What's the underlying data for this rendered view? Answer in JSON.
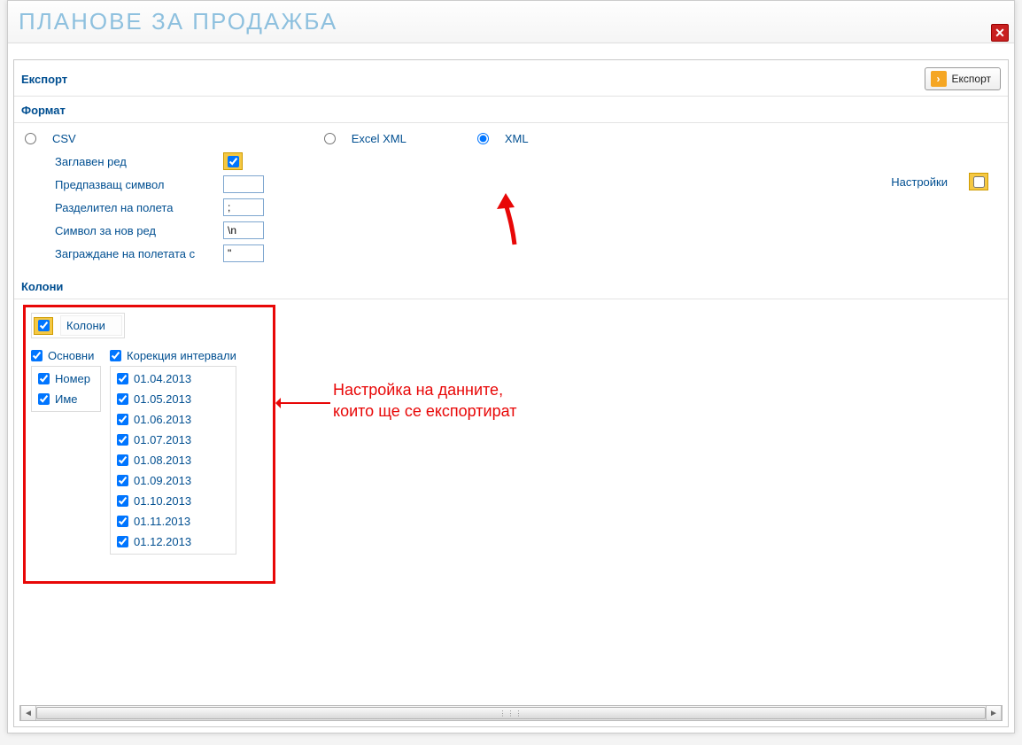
{
  "window": {
    "title": "ПЛАНОВЕ ЗА ПРОДАЖБА"
  },
  "export": {
    "header": "Експорт",
    "button": "Експорт"
  },
  "format": {
    "header": "Формат",
    "csv_label": "CSV",
    "excel_label": "Excel XML",
    "xml_label": "XML",
    "settings_label": "Настройки"
  },
  "csv": {
    "header_row": "Заглавен ред",
    "escape_char": "Предпазващ символ",
    "escape_char_val": "",
    "field_sep": "Разделител на полета",
    "field_sep_val": ";",
    "newline": "Символ за нов ред",
    "newline_val": "\\n",
    "enclose": "Заграждане на полетата с",
    "enclose_val": "\""
  },
  "columns": {
    "header": "Колони",
    "tab_label": "Колони",
    "group_basic": "Основни",
    "group_intervals": "Корекция интервали",
    "basic_items": [
      "Номер",
      "Име"
    ],
    "interval_items": [
      "01.04.2013",
      "01.05.2013",
      "01.06.2013",
      "01.07.2013",
      "01.08.2013",
      "01.09.2013",
      "01.10.2013",
      "01.11.2013",
      "01.12.2013"
    ]
  },
  "annotation": {
    "line1": "Настройка на данните,",
    "line2": "които ще се експортират"
  }
}
